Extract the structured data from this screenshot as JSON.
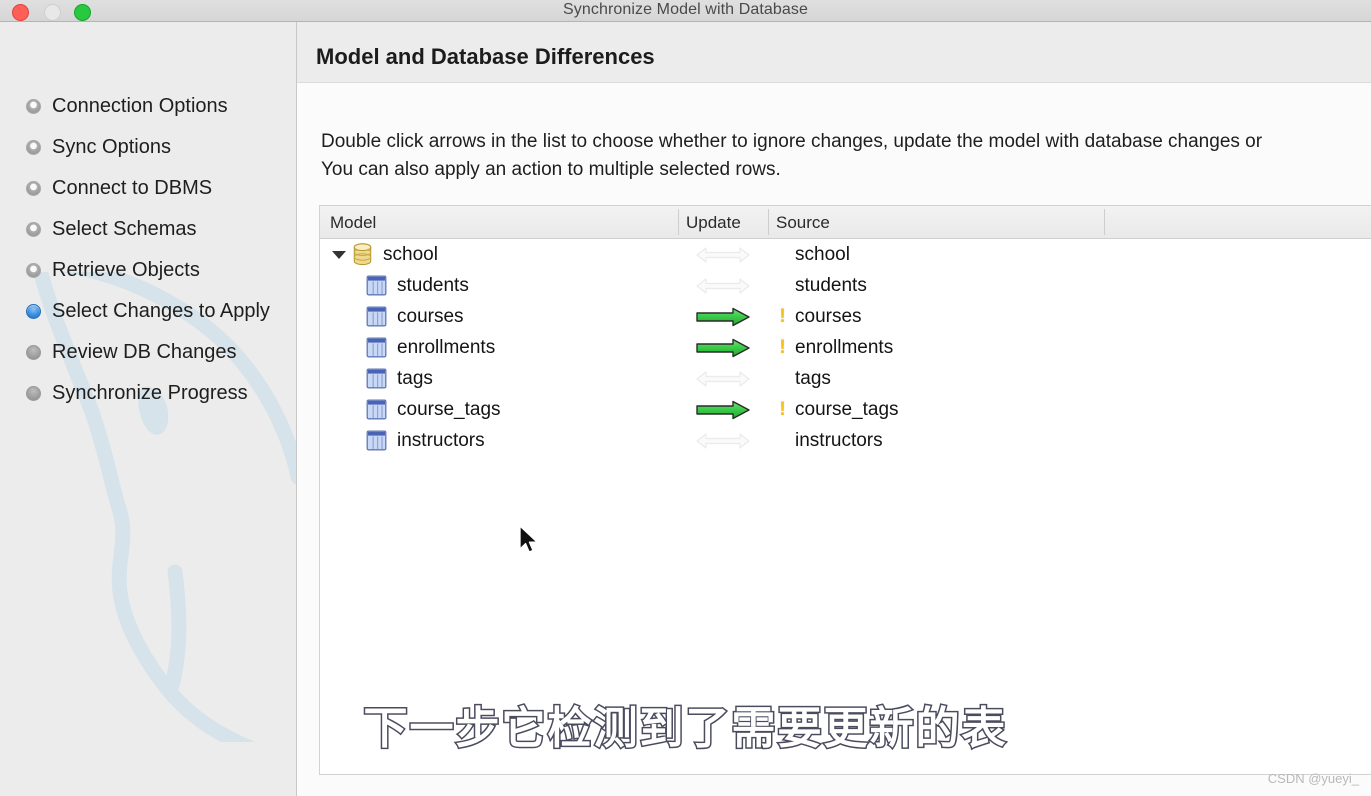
{
  "window": {
    "title": "Synchronize Model with Database",
    "controls": [
      {
        "name": "close",
        "color": "#ff5f57"
      },
      {
        "name": "minimize",
        "color": "#e8e8e8"
      },
      {
        "name": "maximize",
        "color": "#28c840"
      }
    ]
  },
  "sidebar": {
    "steps": [
      {
        "label": "Connection Options",
        "state": "done"
      },
      {
        "label": "Sync Options",
        "state": "done"
      },
      {
        "label": "Connect to DBMS",
        "state": "done"
      },
      {
        "label": "Select Schemas",
        "state": "done"
      },
      {
        "label": "Retrieve Objects",
        "state": "done"
      },
      {
        "label": "Select Changes to Apply",
        "state": "current"
      },
      {
        "label": "Review DB Changes",
        "state": "todo"
      },
      {
        "label": "Synchronize Progress",
        "state": "todo"
      }
    ],
    "watermark_icon": "mysql-dolphin-icon"
  },
  "main": {
    "page_title": "Model and Database Differences",
    "intro_line1": "Double click arrows in the list to choose whether to ignore changes, update the model with database changes or",
    "intro_line2": "You can also apply an action to multiple selected rows.",
    "table": {
      "columns": [
        "Model",
        "Update",
        "Source",
        ""
      ],
      "rows": [
        {
          "model": "school",
          "icon": "database-icon",
          "level": 0,
          "expanded": true,
          "update": "bidirectional-ignore-arrow",
          "source": "school",
          "source_warning": false
        },
        {
          "model": "students",
          "icon": "table-icon",
          "level": 1,
          "expanded": false,
          "update": "bidirectional-ignore-arrow",
          "source": "students",
          "source_warning": false
        },
        {
          "model": "courses",
          "icon": "table-icon",
          "level": 1,
          "expanded": false,
          "update": "update-right-arrow",
          "source": "courses",
          "source_warning": true
        },
        {
          "model": "enrollments",
          "icon": "table-icon",
          "level": 1,
          "expanded": false,
          "update": "update-right-arrow",
          "source": "enrollments",
          "source_warning": true
        },
        {
          "model": "tags",
          "icon": "table-icon",
          "level": 1,
          "expanded": false,
          "update": "bidirectional-ignore-arrow",
          "source": "tags",
          "source_warning": false
        },
        {
          "model": "course_tags",
          "icon": "table-icon",
          "level": 1,
          "expanded": false,
          "update": "update-right-arrow",
          "source": "course_tags",
          "source_warning": true
        },
        {
          "model": "instructors",
          "icon": "table-icon",
          "level": 1,
          "expanded": false,
          "update": "bidirectional-ignore-arrow",
          "source": "instructors",
          "source_warning": false
        }
      ]
    }
  },
  "overlay": {
    "subtitle": "下一步它检测到了需要更新的表",
    "watermark": "CSDN @yueyi_"
  },
  "colors": {
    "accent_blue": "#3c8ee0",
    "update_arrow_green": "#35c33f",
    "ignore_arrow_gray": "#f4f4f4",
    "warning_yellow": "#f5c21a",
    "database_icon_gold": "#edd27a",
    "table_icon_blue": "#9fb6e8"
  }
}
